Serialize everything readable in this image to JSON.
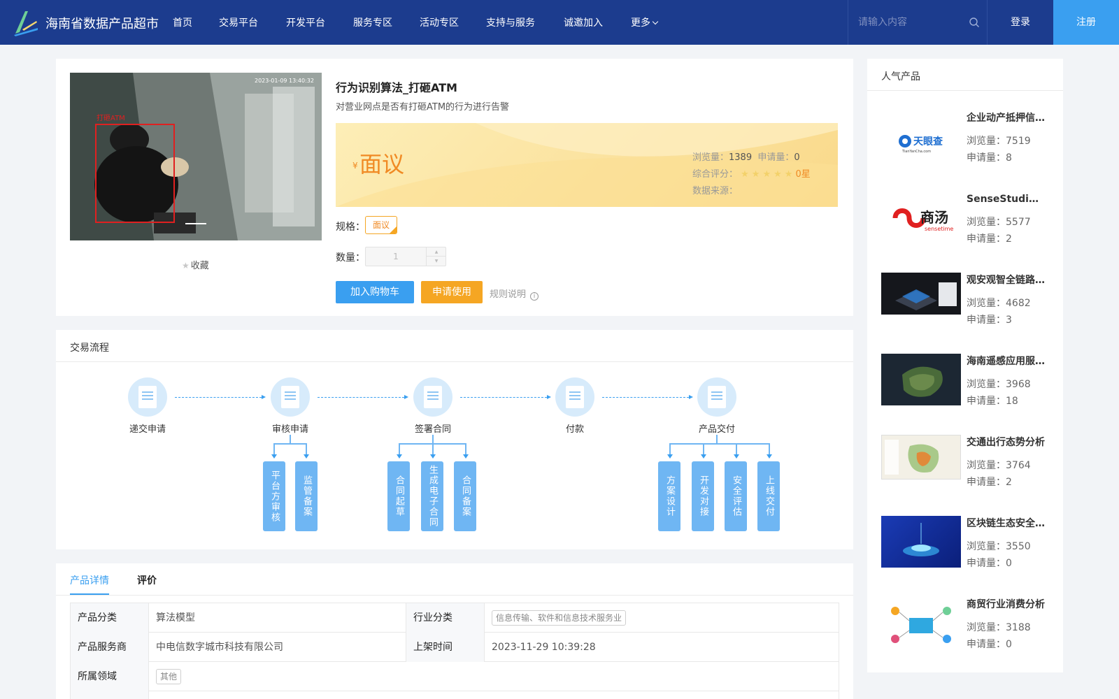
{
  "header": {
    "site_name": "海南省数据产品超市",
    "nav": [
      "首页",
      "交易平台",
      "开发平台",
      "服务专区",
      "活动专区",
      "支持与服务",
      "诚邀加入",
      "更多"
    ],
    "search_placeholder": "请输入内容",
    "login": "登录",
    "register": "注册",
    "brand_color": "#1c3c8e",
    "accent_color": "#3a9ff0"
  },
  "product": {
    "title": "行为识别算法_打砸ATM",
    "description": "对营业网点是否有打砸ATM的行为进行告警",
    "image_timestamp": "2023-01-09 13:40:32",
    "image_tag": "打砸ATM",
    "favorite": "收藏",
    "price": {
      "currency": "¥",
      "value": "面议"
    },
    "stats": {
      "views_label": "浏览量：",
      "views": "1389",
      "applications_label": "申请量：",
      "applications": "0",
      "rating_label": "综合评分：",
      "stars": "★★★★★",
      "rating_value": "0星",
      "source_label": "数据来源："
    },
    "spec_label": "规格：",
    "spec_option": "面议",
    "quantity_label": "数量：",
    "quantity_value": "1",
    "add_to_cart": "加入购物车",
    "apply": "申请使用",
    "rules": "规则说明"
  },
  "process": {
    "title": "交易流程",
    "steps": [
      "递交申请",
      "审核申请",
      "签署合同",
      "付款",
      "产品交付"
    ],
    "substeps": {
      "review": [
        "平台方审核",
        "监管备案"
      ],
      "contract": [
        "合同起草",
        "生成电子合同",
        "合同备案"
      ],
      "delivery": [
        "方案设计",
        "开发对接",
        "安全评估",
        "上线交付"
      ]
    }
  },
  "detail": {
    "tabs": [
      "产品详情",
      "评价"
    ],
    "rows": {
      "category_label": "产品分类",
      "category": "算法模型",
      "industry_label": "行业分类",
      "industry": "信息传输、软件和信息技术服务业",
      "provider_label": "产品服务商",
      "provider": "中电信数字城市科技有限公司",
      "listed_label": "上架时间",
      "listed": "2023-11-29 10:39:28",
      "domain_label": "所属领域",
      "domain": "其他"
    }
  },
  "sidebar": {
    "title": "人气产品",
    "items": [
      {
        "name": "企业动产抵押信息查询",
        "views": "浏览量：7519",
        "apps": "申请量：8",
        "logo_text": "天眼查",
        "logo_sub": "TianYanCha.com"
      },
      {
        "name": "SenseStudio人工智能平台",
        "views": "浏览量：5577",
        "apps": "申请量：2",
        "logo_text": "商汤",
        "logo_sub": "sensetime"
      },
      {
        "name": "观安观智全链路数据安全",
        "views": "浏览量：4682",
        "apps": "申请量：3"
      },
      {
        "name": "海南遥感应用服务平台",
        "views": "浏览量：3968",
        "apps": "申请量：18"
      },
      {
        "name": "交通出行态势分析",
        "views": "浏览量：3764",
        "apps": "申请量：2"
      },
      {
        "name": "区块链生态安全服务",
        "views": "浏览量：3550",
        "apps": "申请量：0"
      },
      {
        "name": "商贸行业消费分析",
        "views": "浏览量：3188",
        "apps": "申请量：0"
      }
    ]
  }
}
